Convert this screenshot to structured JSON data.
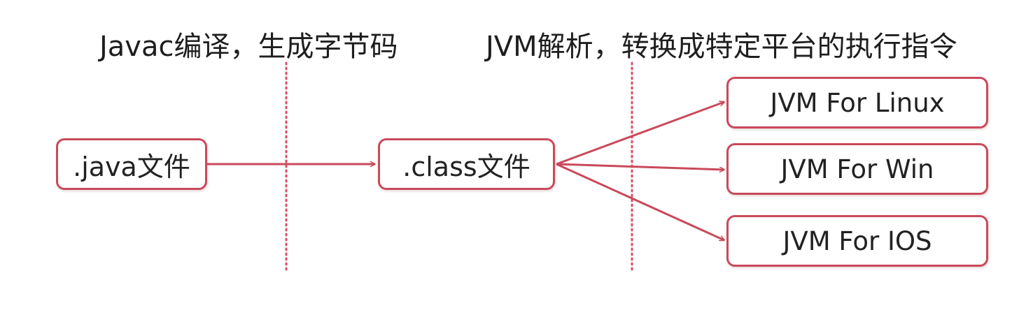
{
  "colors": {
    "accent": "#c94a5b",
    "divider": "#d9506a",
    "text": "#1e1e1e"
  },
  "stages": {
    "compile_label": "Javac编译，生成字节码",
    "jvm_label": "JVM解析，转换成特定平台的执行指令"
  },
  "nodes": {
    "source": ".java文件",
    "bytecode": ".class文件",
    "targets": [
      "JVM For Linux",
      "JVM For Win",
      "JVM For IOS"
    ]
  }
}
